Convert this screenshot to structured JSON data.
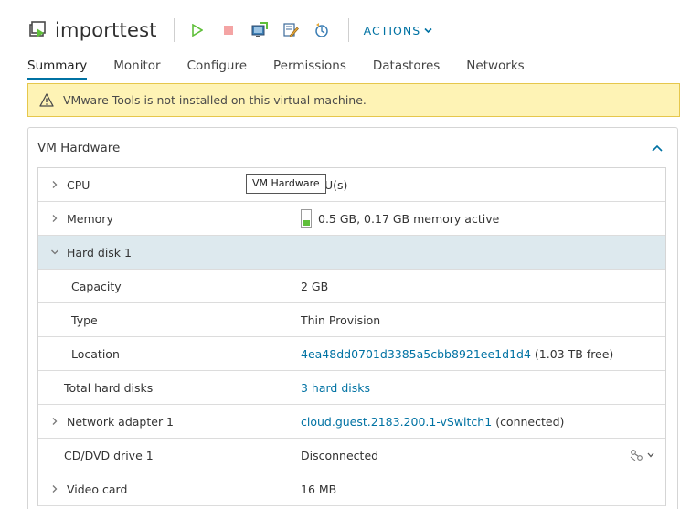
{
  "header": {
    "vm_name": "importtest",
    "actions_label": "ACTIONS",
    "icons": [
      "vm-icon",
      "power-on-icon",
      "power-off-icon",
      "launch-console-icon",
      "edit-settings-icon",
      "snapshot-icon",
      "chevron-down-icon"
    ]
  },
  "tabs": [
    {
      "label": "Summary",
      "active": true
    },
    {
      "label": "Monitor"
    },
    {
      "label": "Configure"
    },
    {
      "label": "Permissions"
    },
    {
      "label": "Datastores"
    },
    {
      "label": "Networks"
    }
  ],
  "alert": {
    "text": "VMware Tools is not installed on this virtual machine.",
    "icon": "warning-icon",
    "color": "#fef3b5"
  },
  "card": {
    "title": "VM Hardware",
    "tooltip": "VM Hardware"
  },
  "hardware": {
    "cpu": {
      "label": "CPU",
      "value": "U(s)"
    },
    "memory": {
      "label": "Memory",
      "value": "0.5 GB, 0.17 GB memory active",
      "active_fraction": 0.34
    },
    "hard_disk": {
      "label": "Hard disk 1"
    },
    "capacity": {
      "label": "Capacity",
      "value": "2 GB"
    },
    "type": {
      "label": "Type",
      "value": "Thin Provision"
    },
    "location": {
      "label": "Location",
      "link": "4ea48dd0701d3385a5cbb8921ee1d1d4",
      "extra": "(1.03 TB free)"
    },
    "total_disks": {
      "label": "Total hard disks",
      "link": "3 hard disks"
    },
    "network": {
      "label": "Network adapter 1",
      "link": "cloud.guest.2183.200.1-vSwitch1",
      "extra": "(connected)"
    },
    "cdrom": {
      "label": "CD/DVD drive 1",
      "value": "Disconnected"
    },
    "video": {
      "label": "Video card",
      "value": "16 MB"
    }
  },
  "colors": {
    "accent": "#0072a3",
    "selected_row": "#dde9ee",
    "power_on": "#5fbf3a",
    "power_off": "#f4a4a4"
  }
}
